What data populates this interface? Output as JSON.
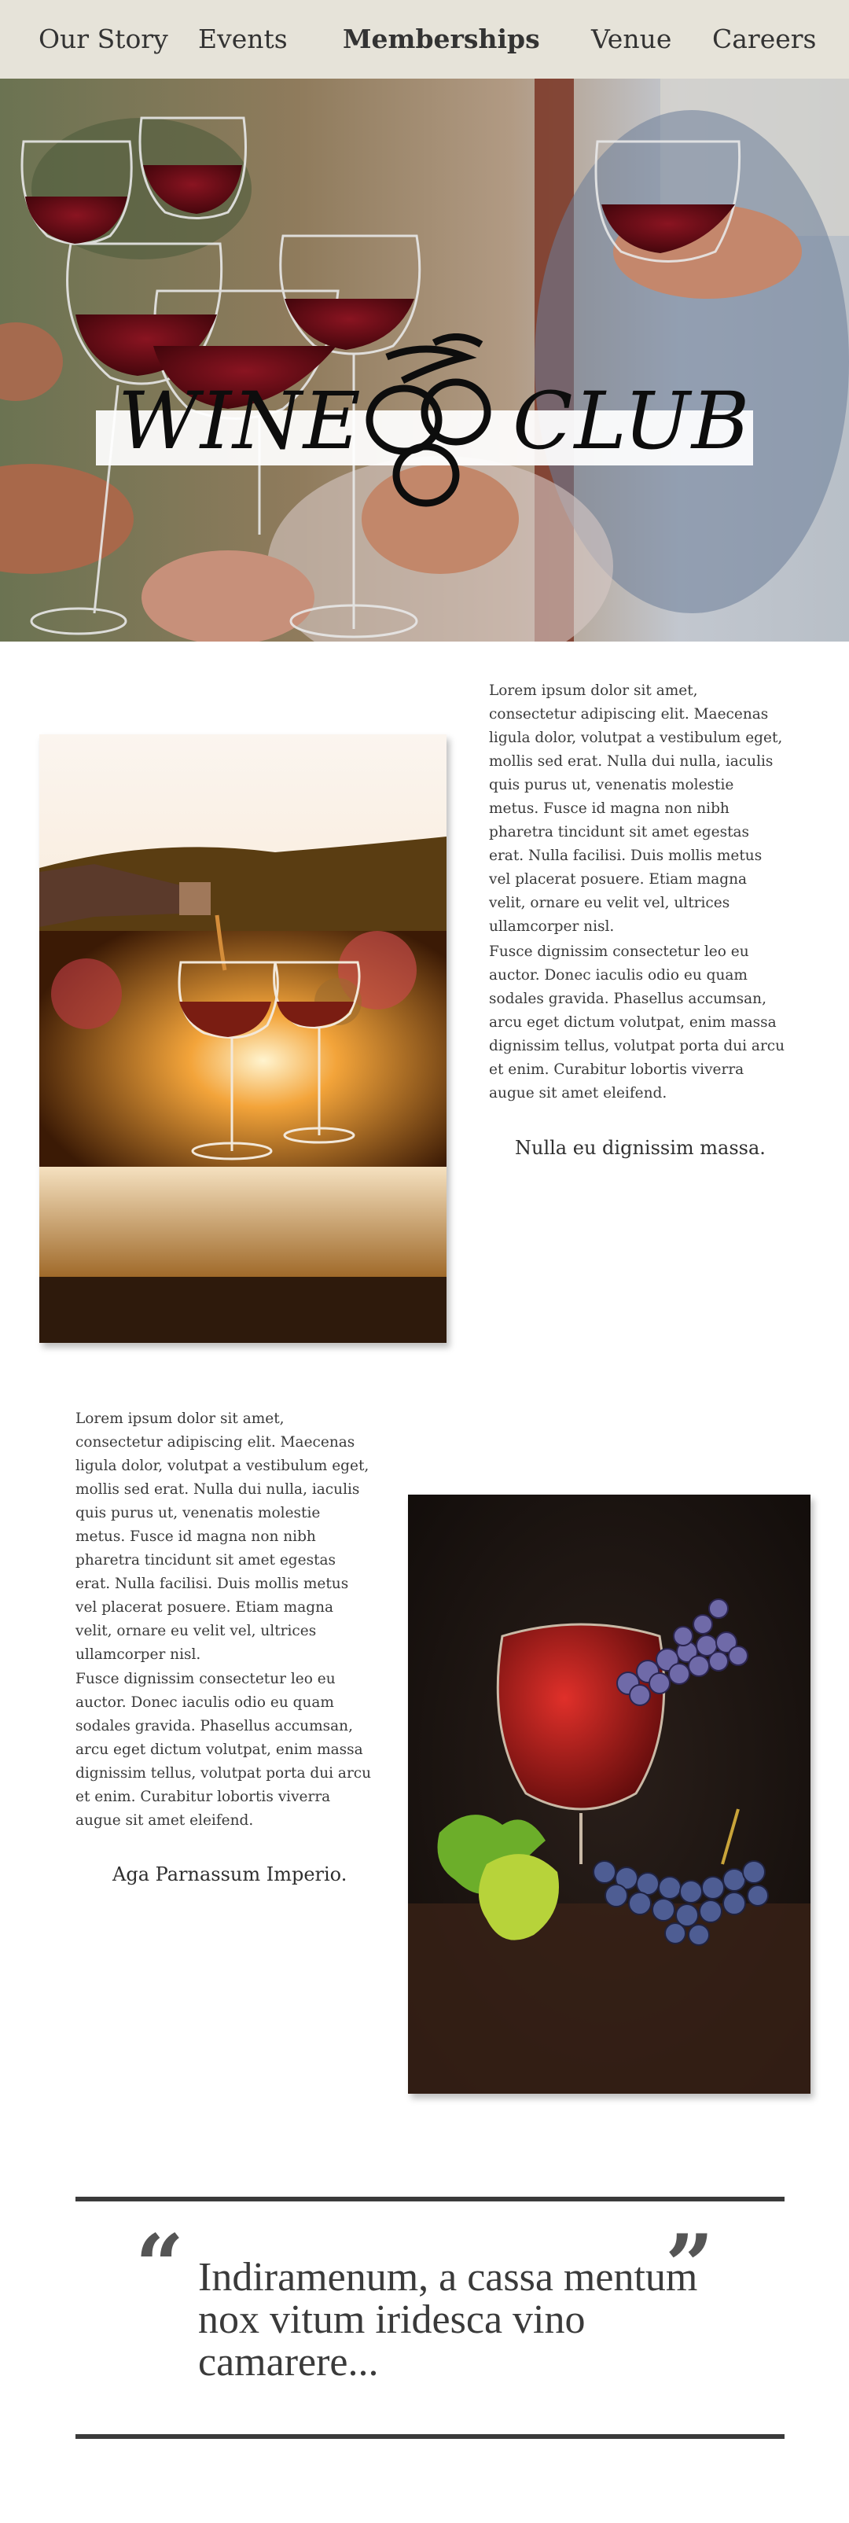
{
  "nav": {
    "items": [
      {
        "label": "Our Story"
      },
      {
        "label": "Events"
      },
      {
        "label": "Memberships"
      },
      {
        "label": "Venue"
      },
      {
        "label": "Careers"
      }
    ]
  },
  "hero": {
    "word_left": "WINE",
    "word_right": "CLUB"
  },
  "section1": {
    "para1": "Lorem ipsum dolor sit amet, consectetur adipiscing elit. Maecenas ligula dolor, volutpat a vestibulum eget, mollis sed erat. Nulla dui nulla, iaculis quis purus ut, venenatis molestie metus. Fusce id magna non nibh pharetra tincidunt sit amet egestas erat. Nulla facilisi. Duis mollis metus vel placerat posuere. Etiam magna velit, ornare eu velit vel, ultrices ullamcorper nisl.",
    "para2": "Fusce dignissim consectetur leo eu auctor. Donec iaculis odio eu quam sodales gravida. Phasellus accumsan, arcu eget dictum volutpat, enim massa dignissim tellus, volutpat porta dui arcu et enim. Curabitur lobortis viverra augue sit amet eleifend.",
    "tagline": "Nulla eu dignissim massa."
  },
  "section2": {
    "para1": "Lorem ipsum dolor sit amet, consectetur adipiscing elit. Maecenas ligula dolor, volutpat a vestibulum eget, mollis sed erat. Nulla dui nulla, iaculis quis purus ut, venenatis molestie metus. Fusce id magna non nibh pharetra tincidunt sit amet egestas erat. Nulla facilisi. Duis mollis metus vel placerat posuere. Etiam magna velit, ornare eu velit vel, ultrices ullamcorper nisl.",
    "para2": "Fusce dignissim consectetur leo eu auctor. Donec iaculis odio eu quam sodales gravida. Phasellus accumsan, arcu eget dictum volutpat, enim massa dignissim tellus, volutpat porta dui arcu et enim. Curabitur lobortis viverra augue sit amet eleifend.",
    "tagline": "Aga Parnassum Imperio."
  },
  "quote": {
    "open_mark": "“",
    "close_mark": "”",
    "text": "Indiramenum, a cassa mentum nox vitum iridesca vino camarere..."
  },
  "colors": {
    "nav_bg": "#e6e3d9",
    "text": "#2f2f2f",
    "wine": "#5a0a12",
    "rule": "#3a3a3a"
  }
}
